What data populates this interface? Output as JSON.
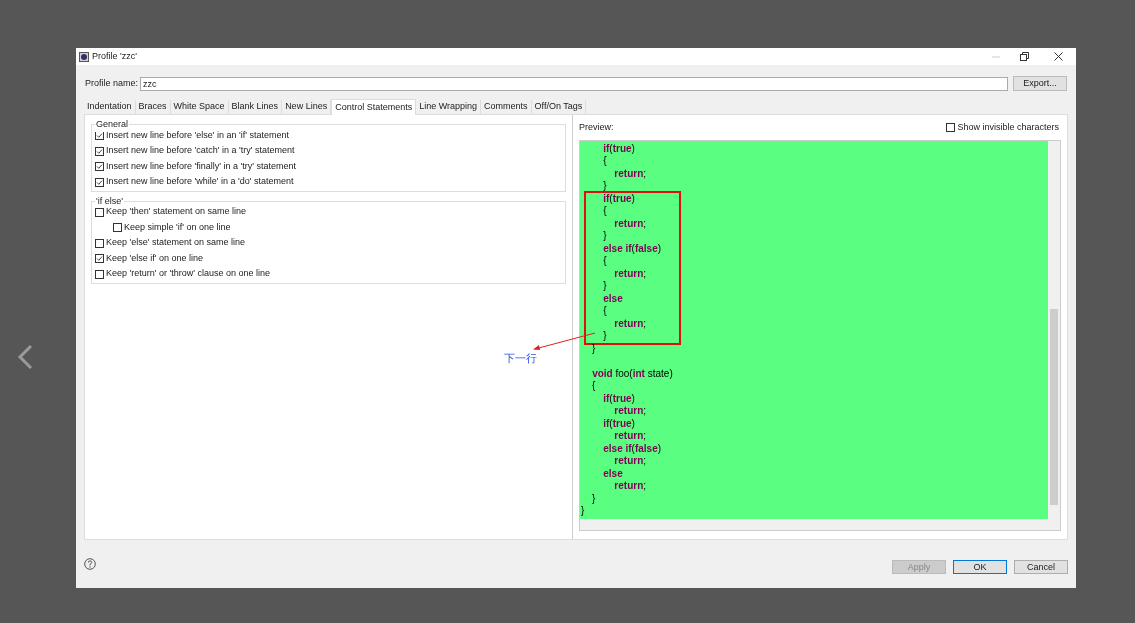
{
  "window": {
    "title": "Profile 'zzc'"
  },
  "profile_name": {
    "label": "Profile name:",
    "value": "zzc"
  },
  "export_button": {
    "label": "Export..."
  },
  "tabs": [
    {
      "label": "Indentation",
      "selected": false
    },
    {
      "label": "Braces",
      "selected": false
    },
    {
      "label": "White Space",
      "selected": false
    },
    {
      "label": "Blank Lines",
      "selected": false
    },
    {
      "label": "New Lines",
      "selected": false
    },
    {
      "label": "Control Statements",
      "selected": true
    },
    {
      "label": "Line Wrapping",
      "selected": false
    },
    {
      "label": "Comments",
      "selected": false
    },
    {
      "label": "Off/On Tags",
      "selected": false
    }
  ],
  "groups": [
    {
      "title": "General",
      "options": [
        {
          "label": "Insert new line before 'else' in an 'if' statement",
          "checked": true
        },
        {
          "label": "Insert new line before 'catch' in a 'try' statement",
          "checked": true
        },
        {
          "label": "Insert new line before 'finally' in a 'try' statement",
          "checked": true
        },
        {
          "label": "Insert new line before 'while' in a 'do' statement",
          "checked": true
        }
      ]
    },
    {
      "title": "'if else'",
      "options": [
        {
          "label": "Keep 'then' statement on same line",
          "checked": false,
          "children": [
            {
              "label": "Keep simple 'if' on one line",
              "checked": false
            }
          ]
        },
        {
          "label": "Keep 'else' statement on same line",
          "checked": false
        },
        {
          "label": "Keep 'else if' on one line",
          "checked": true
        },
        {
          "label": "Keep 'return' or 'throw' clause on one line",
          "checked": false
        }
      ]
    }
  ],
  "preview": {
    "label": "Preview:",
    "show_invisible": {
      "label": "Show invisible characters",
      "checked": false
    },
    "code_lines": [
      {
        "text": "        **if**(**true**)",
        "boxed": false
      },
      {
        "text": "        {",
        "boxed": false
      },
      {
        "text": "            **return**;",
        "boxed": false
      },
      {
        "text": "        }",
        "boxed": false
      },
      {
        "text": "        **if**(**true**)",
        "boxed": true
      },
      {
        "text": "        {",
        "boxed": true
      },
      {
        "text": "            **return**;",
        "boxed": true
      },
      {
        "text": "        }",
        "boxed": true
      },
      {
        "text": "        **else** **if**(**false**)",
        "boxed": true
      },
      {
        "text": "        {",
        "boxed": true
      },
      {
        "text": "            **return**;",
        "boxed": true
      },
      {
        "text": "        }",
        "boxed": true
      },
      {
        "text": "        **else**",
        "boxed": true
      },
      {
        "text": "        {",
        "boxed": true
      },
      {
        "text": "            **return**;",
        "boxed": true
      },
      {
        "text": "        }",
        "boxed": true
      },
      {
        "text": "    }",
        "boxed": false
      },
      {
        "text": "    **void** foo(**int** state)",
        "boxed": false,
        "gap_before": true
      },
      {
        "text": "    {",
        "boxed": false
      },
      {
        "text": "        **if**(**true**)",
        "boxed": false
      },
      {
        "text": "            **return**;",
        "boxed": false
      },
      {
        "text": "        **if**(**true**)",
        "boxed": false
      },
      {
        "text": "            **return**;",
        "boxed": false
      },
      {
        "text": "        **else** **if**(**false**)",
        "boxed": false
      },
      {
        "text": "            **return**;",
        "boxed": false
      },
      {
        "text": "        **else**",
        "boxed": false
      },
      {
        "text": "            **return**;",
        "boxed": false
      },
      {
        "text": "    }",
        "boxed": false
      },
      {
        "text": "}",
        "boxed": false
      }
    ]
  },
  "annotation": {
    "text": "下一行"
  },
  "buttons": [
    {
      "label": "Apply",
      "disabled": true,
      "default": false
    },
    {
      "label": "OK",
      "disabled": false,
      "default": true
    },
    {
      "label": "Cancel",
      "disabled": false,
      "default": false
    }
  ]
}
